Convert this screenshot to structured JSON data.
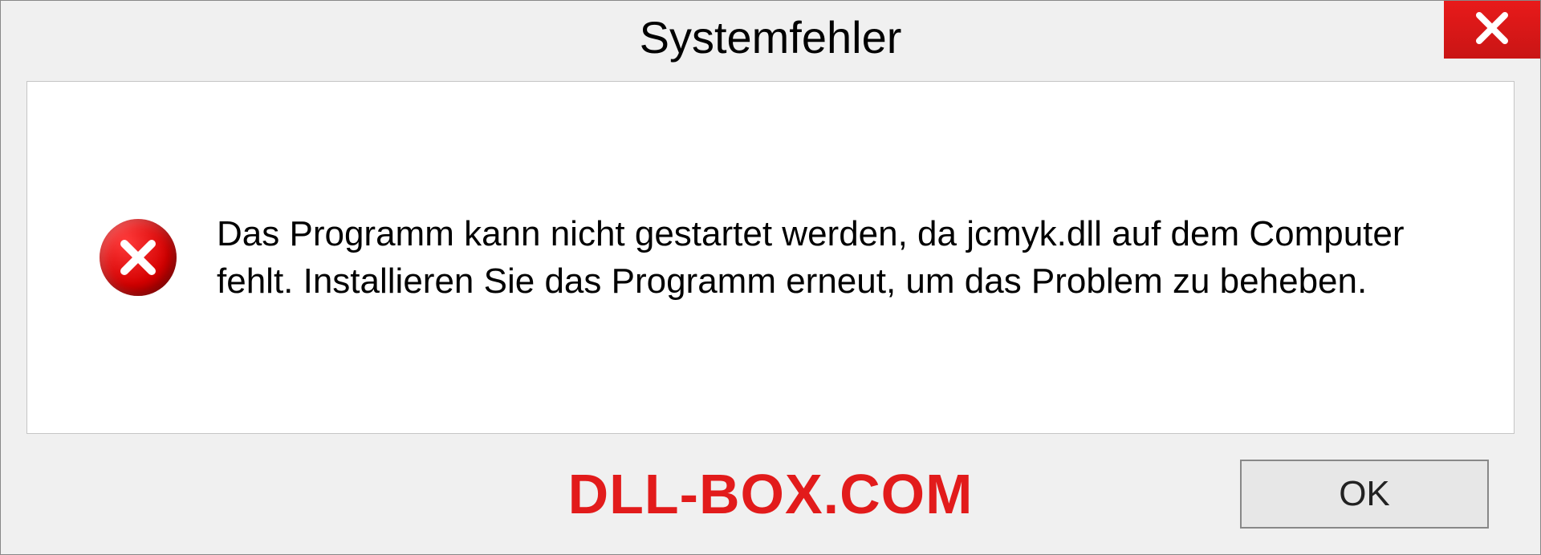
{
  "dialog": {
    "title": "Systemfehler",
    "message": "Das Programm kann nicht gestartet werden, da jcmyk.dll auf dem Computer fehlt. Installieren Sie das Programm erneut, um das Problem zu beheben.",
    "ok_label": "OK"
  },
  "watermark": "DLL-BOX.COM"
}
